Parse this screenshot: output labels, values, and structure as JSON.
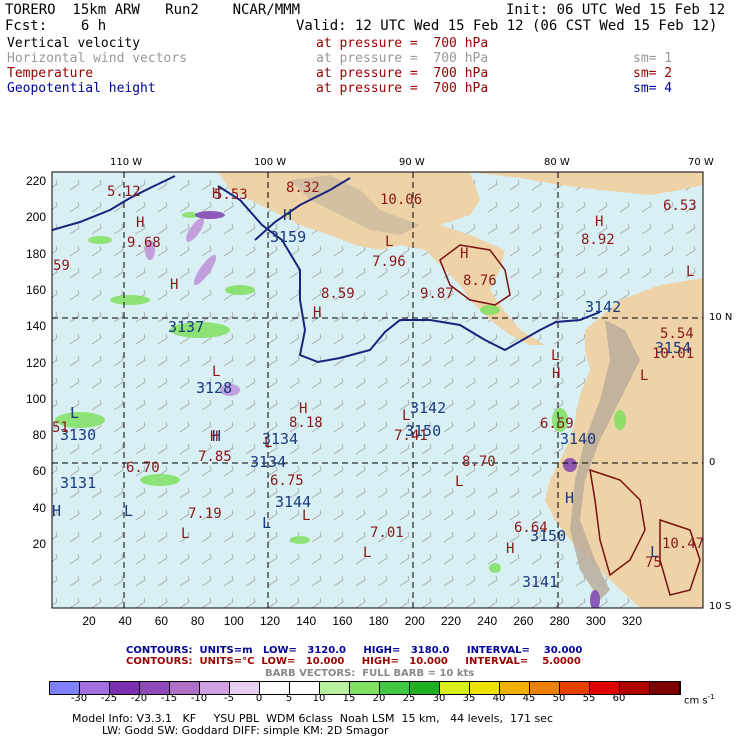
{
  "header": {
    "left1": "TORERO  15km ARW   Run2    NCAR/MMM",
    "right1": "Init: 06 UTC Wed 15 Feb 12",
    "left2": "Fcst:    6 h",
    "right2": "Valid: 12 UTC Wed 15 Feb 12 (06 CST Wed 15 Feb 12)"
  },
  "fields": [
    {
      "name": "Vertical velocity",
      "pressure": "at pressure =  700 hPa",
      "sm": "",
      "color": "#000000"
    },
    {
      "name": "Horizontal wind vectors",
      "pressure": "at pressure =  700 hPa",
      "sm": "sm= 1",
      "color": "#999999"
    },
    {
      "name": "Temperature",
      "pressure": "at pressure =  700 hPa",
      "sm": "sm= 2",
      "color": "#990000"
    },
    {
      "name": "Geopotential height",
      "pressure": "at pressure =  700 hPa",
      "sm": "sm= 4",
      "color": "#000099"
    }
  ],
  "pressure_color": "#990000",
  "map": {
    "lon_labels": [
      "110 W",
      "100 W",
      "90 W",
      "80 W",
      "70 W"
    ],
    "lat_labels": [
      "10 N",
      "0",
      "10 S"
    ],
    "x_ticks": [
      "20",
      "40",
      "60",
      "80",
      "100",
      "120",
      "140",
      "160",
      "180",
      "200",
      "220",
      "240",
      "260",
      "280",
      "300",
      "320"
    ],
    "y_ticks": [
      "220",
      "200",
      "180",
      "160",
      "140",
      "120",
      "100",
      "80",
      "60",
      "40",
      "20"
    ],
    "height_labels": [
      {
        "t": "H",
        "c": "h"
      },
      {
        "t": "3159",
        "c": "h"
      },
      {
        "t": "3137",
        "c": "h"
      },
      {
        "t": "3128",
        "c": "h"
      },
      {
        "t": "L",
        "c": "h"
      },
      {
        "t": "3130",
        "c": "h"
      },
      {
        "t": "H",
        "c": "h"
      },
      {
        "t": "3134",
        "c": "h"
      },
      {
        "t": "3131",
        "c": "h"
      },
      {
        "t": "L",
        "c": "h"
      },
      {
        "t": "3134",
        "c": "h"
      },
      {
        "t": "H",
        "c": "h"
      },
      {
        "t": "3144",
        "c": "h"
      },
      {
        "t": "L",
        "c": "h"
      },
      {
        "t": "3142",
        "c": "h"
      },
      {
        "t": "3150",
        "c": "h"
      },
      {
        "t": "3142",
        "c": "h"
      },
      {
        "t": "3140",
        "c": "h"
      },
      {
        "t": "3154",
        "c": "h"
      },
      {
        "t": "H",
        "c": "h"
      },
      {
        "t": "3150",
        "c": "h"
      },
      {
        "t": "3141",
        "c": "h"
      },
      {
        "t": "L",
        "c": "h"
      }
    ],
    "temp_labels": [
      {
        "t": "5.12"
      },
      {
        "t": "H"
      },
      {
        "t": "5.53"
      },
      {
        "t": "8.32"
      },
      {
        "t": "10.06"
      },
      {
        "t": "H"
      },
      {
        "t": "9.68"
      },
      {
        "t": "59"
      },
      {
        "t": "L"
      },
      {
        "t": "7.96"
      },
      {
        "t": "H"
      },
      {
        "t": "8.76"
      },
      {
        "t": "H"
      },
      {
        "t": "8.92"
      },
      {
        "t": "L"
      },
      {
        "t": "6.53"
      },
      {
        "t": "H"
      },
      {
        "t": "8.59"
      },
      {
        "t": "H"
      },
      {
        "t": "9.87"
      },
      {
        "t": "L"
      },
      {
        "t": "H"
      },
      {
        "t": "10.01"
      },
      {
        "t": "L"
      },
      {
        "t": "5.54"
      },
      {
        "t": "L"
      },
      {
        "t": "H"
      },
      {
        "t": "8.18"
      },
      {
        "t": "L"
      },
      {
        "t": "7.41"
      },
      {
        "t": "6.59"
      },
      {
        "t": "51"
      },
      {
        "t": "H"
      },
      {
        "t": "7.85"
      },
      {
        "t": "6.70"
      },
      {
        "t": "L"
      },
      {
        "t": "8.70"
      },
      {
        "t": "L"
      },
      {
        "t": "6.75"
      },
      {
        "t": "L"
      },
      {
        "t": "7.19"
      },
      {
        "t": "L"
      },
      {
        "t": "7.01"
      },
      {
        "t": "L"
      },
      {
        "t": "6.64"
      },
      {
        "t": "H"
      },
      {
        "t": "10.47"
      },
      {
        "t": "75"
      }
    ]
  },
  "info": {
    "row1_a": "CONTOURS:  UNITS=m   LOW=   3120.0     HIGH=   3180.0     INTERVAL=    30.000",
    "row2_a": "CONTOURS:  UNITS=°C  LOW=   10.000     HIGH=   10.000     INTERVAL=    5.0000",
    "row3": "BARB VECTORS:  FULL BARB = 10 kts",
    "row1_color": "#000099",
    "row2_color": "#990000",
    "row3_color": "#888888"
  },
  "colorbar": {
    "labels": [
      "-30",
      "-25",
      "-20",
      "-15",
      "-10",
      "-5",
      "0",
      "5",
      "10",
      "15",
      "20",
      "25",
      "30",
      "35",
      "40",
      "45",
      "50",
      "55",
      "60"
    ],
    "units": "cm s",
    "units_exp": "-1",
    "colors": [
      "#8080ff",
      "#a070e0",
      "#7a30b0",
      "#8e4ab8",
      "#b070c8",
      "#d0a0e0",
      "#e8d0f0",
      "#ffffff",
      "#ffffff",
      "#b8f0a0",
      "#80e060",
      "#40c840",
      "#20b020",
      "#d8f020",
      "#f0e000",
      "#f0b000",
      "#f08000",
      "#e84000",
      "#e00000",
      "#b00000",
      "#800000"
    ]
  },
  "footer": {
    "line1": "Model Info: V3.3.1   KF     YSU PBL  WDM 6class  Noah LSM  15 km,   44 levels,  171 sec",
    "line2": "LW: Godd SW: Goddard DIFF: simple KM: 2D Smagor"
  }
}
